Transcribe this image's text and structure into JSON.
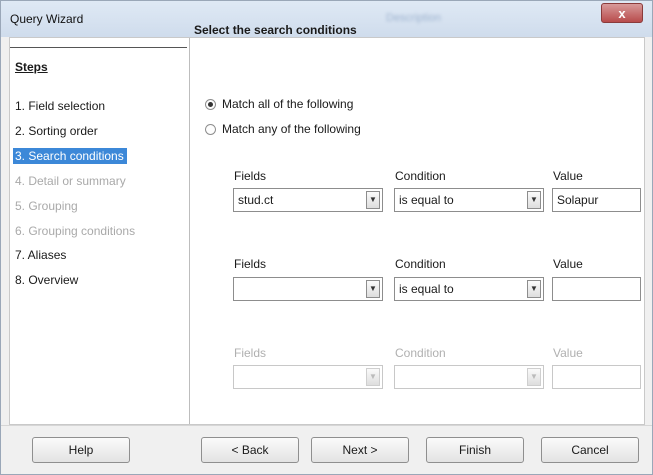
{
  "window": {
    "title": "Query Wizard",
    "ghost_title": "Description",
    "close_label": "x"
  },
  "steps": {
    "title": "Steps",
    "items": [
      {
        "label": "1. Field selection",
        "state": "normal"
      },
      {
        "label": "2. Sorting order",
        "state": "normal"
      },
      {
        "label": "3. Search conditions",
        "state": "active"
      },
      {
        "label": "4. Detail or summary",
        "state": "disabled"
      },
      {
        "label": "5. Grouping",
        "state": "disabled"
      },
      {
        "label": "6. Grouping conditions",
        "state": "disabled"
      },
      {
        "label": "7. Aliases",
        "state": "normal"
      },
      {
        "label": "8. Overview",
        "state": "normal"
      }
    ]
  },
  "main": {
    "title": "Select the search conditions",
    "match_all": "Match all of the following",
    "match_any": "Match any of the following",
    "selected_match": "all",
    "conditions": [
      {
        "fields_label": "Fields",
        "condition_label": "Condition",
        "value_label": "Value",
        "field": "stud.ct",
        "condition": "is equal to",
        "value": "Solapur",
        "enabled": true
      },
      {
        "fields_label": "Fields",
        "condition_label": "Condition",
        "value_label": "Value",
        "field": "",
        "condition": "is equal to",
        "value": "",
        "enabled": true
      },
      {
        "fields_label": "Fields",
        "condition_label": "Condition",
        "value_label": "Value",
        "field": "",
        "condition": "",
        "value": "",
        "enabled": false
      }
    ]
  },
  "buttons": {
    "help": "Help",
    "back": "< Back",
    "next": "Next >",
    "finish": "Finish",
    "cancel": "Cancel"
  },
  "icons": {
    "dropdown": "chevron-down-icon",
    "close": "close-icon"
  }
}
